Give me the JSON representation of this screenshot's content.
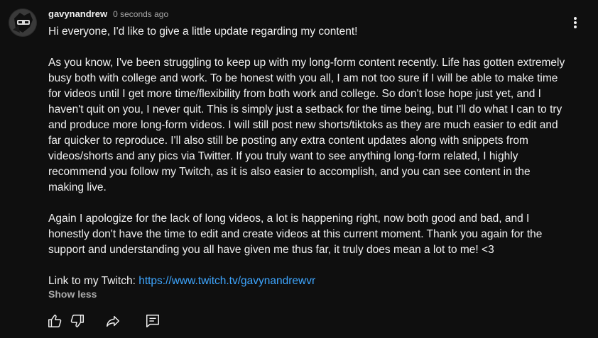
{
  "comment": {
    "author": "gavynandrew",
    "timestamp": "0 seconds ago",
    "paragraphs": [
      "Hi everyone, I'd like to give a little update regarding my content!",
      "As you know,  I've been struggling to keep up with my long-form content recently. Life has gotten extremely busy both with college and work. To be honest with you all, I am not too sure if I will be able to make time for videos until I get more time/flexibility from both work and college. So don't lose hope just yet, and I haven't quit on you, I never quit. This is simply just a setback for the time being, but I'll do what I can to try and produce more long-form videos. I will still post new shorts/tiktoks as they are much easier to edit and far quicker to reproduce. I'll also still be posting any extra content updates along with snippets from videos/shorts and any pics via Twitter. If you truly want to see anything long-form related, I highly recommend you follow my Twitch, as it is also easier to accomplish, and you can see content in the making live.",
      "Again I apologize for the lack of long videos, a lot is happening right, now both good and bad, and I honestly don't have the time to edit and create videos at this current moment. Thank you again for the support and understanding you all have given me thus far, it truly does mean a lot to me! <3"
    ],
    "link_prefix": "Link to my Twitch: ",
    "link_text": "https://www.twitch.tv/gavynandrewvr",
    "show_less_label": "Show less"
  },
  "icons": {
    "menu": "more-vert-icon",
    "like": "thumbs-up-icon",
    "dislike": "thumbs-down-icon",
    "share": "share-icon",
    "reply": "reply-comment-icon"
  },
  "colors": {
    "background": "#0f0f0f",
    "text": "#f1f1f1",
    "secondary_text": "#aaaaaa",
    "link": "#3ea6ff"
  }
}
